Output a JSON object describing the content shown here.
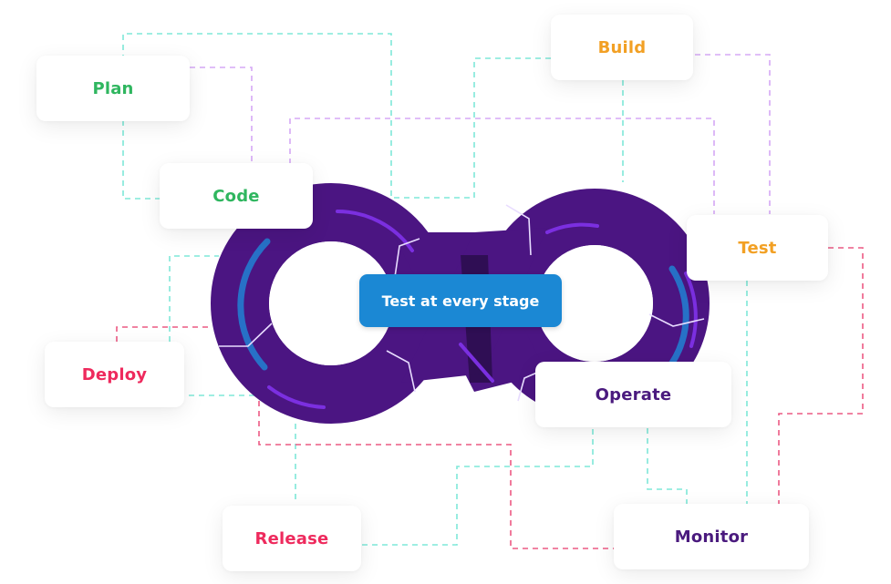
{
  "diagram": {
    "center_label": "Test at every stage",
    "stages": [
      {
        "id": "plan",
        "label": "Plan",
        "color": "#2fb65f"
      },
      {
        "id": "code",
        "label": "Code",
        "color": "#2fb65f"
      },
      {
        "id": "build",
        "label": "Build",
        "color": "#f2a024"
      },
      {
        "id": "test",
        "label": "Test",
        "color": "#f2a024"
      },
      {
        "id": "deploy",
        "label": "Deploy",
        "color": "#ee2a5d"
      },
      {
        "id": "release",
        "label": "Release",
        "color": "#ee2a5d"
      },
      {
        "id": "operate",
        "label": "Operate",
        "color": "#4a1a7e"
      },
      {
        "id": "monitor",
        "label": "Monitor",
        "color": "#4a1a7e"
      }
    ],
    "colors": {
      "loop": "#4b1582",
      "loop_accent": "#7b2fe0",
      "loop_glow": "#1e88d8",
      "pill": "#1b88d4",
      "line_teal": "#7ee8d8",
      "line_purple": "#d5a8f5",
      "line_pink": "#ec5a84"
    }
  }
}
